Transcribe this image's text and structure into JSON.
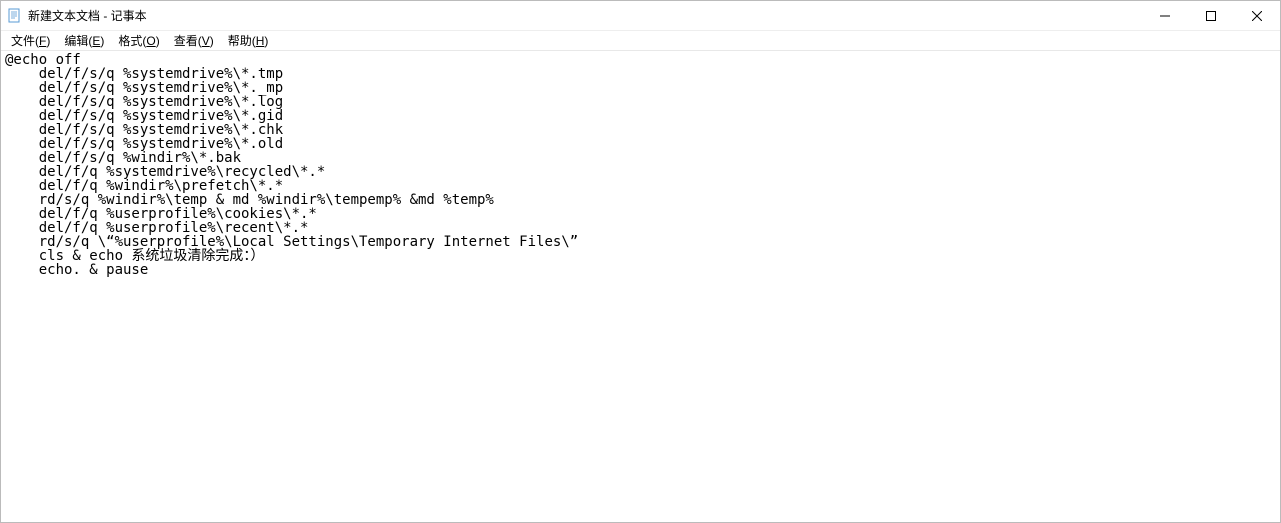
{
  "titlebar": {
    "title": "新建文本文档 - 记事本"
  },
  "menu": {
    "file": "文件(F)",
    "edit": "编辑(E)",
    "format": "格式(O)",
    "view": "查看(V)",
    "help": "帮助(H)"
  },
  "content": "@echo off\n    del/f/s/q %systemdrive%\\*.tmp\n    del/f/s/q %systemdrive%\\*._mp\n    del/f/s/q %systemdrive%\\*.log\n    del/f/s/q %systemdrive%\\*.gid\n    del/f/s/q %systemdrive%\\*.chk\n    del/f/s/q %systemdrive%\\*.old\n    del/f/s/q %windir%\\*.bak\n    del/f/q %systemdrive%\\recycled\\*.*\n    del/f/q %windir%\\prefetch\\*.*\n    rd/s/q %windir%\\temp & md %windir%\\tempemp% &md %temp%\n    del/f/q %userprofile%\\cookies\\*.*\n    del/f/q %userprofile%\\recent\\*.*\n    rd/s/q \\“%userprofile%\\Local Settings\\Temporary Internet Files\\”\n    cls & echo 系统垃圾清除完成：）\n    echo. & pause"
}
